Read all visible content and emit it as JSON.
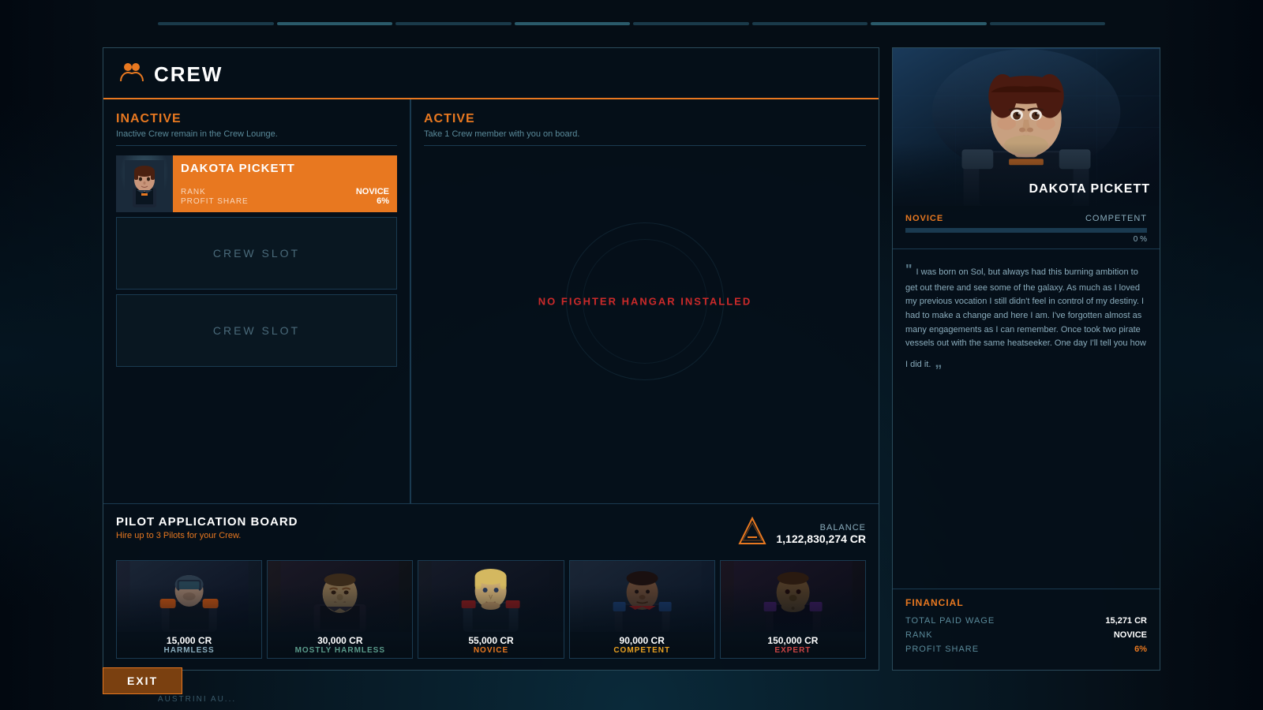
{
  "page": {
    "title": "CREW",
    "background_color": "#050d15"
  },
  "header": {
    "crew_icon": "👥",
    "title": "CREW"
  },
  "inactive_section": {
    "title": "INACTIVE",
    "subtitle": "Inactive Crew remain in the Crew Lounge.",
    "crew_member": {
      "name": "DAKOTA PICKETT",
      "rank_label": "RANK",
      "rank_value": "NOVICE",
      "profit_share_label": "PROFIT SHARE",
      "profit_share_value": "6%"
    },
    "slots": [
      {
        "label": "CREW SLOT"
      },
      {
        "label": "CREW SLOT"
      }
    ]
  },
  "active_section": {
    "title": "ACTIVE",
    "subtitle": "Take 1 Crew member with you on board.",
    "no_hangar_message": "NO FIGHTER HANGAR INSTALLED"
  },
  "pilot_board": {
    "title": "PILOT APPLICATION BOARD",
    "subtitle": "Hire up to 3 Pilots for your Crew.",
    "balance_label": "BALANCE",
    "balance_amount": "1,122,830,274 CR",
    "pilots": [
      {
        "cost": "15,000 CR",
        "rank": "HARMLESS",
        "rank_class": "rank-harmless"
      },
      {
        "cost": "30,000 CR",
        "rank": "MOSTLY HARMLESS",
        "rank_class": "rank-mostly-harmless"
      },
      {
        "cost": "55,000 CR",
        "rank": "NOVICE",
        "rank_class": "rank-novice"
      },
      {
        "cost": "90,000 CR",
        "rank": "COMPETENT",
        "rank_class": "rank-competent"
      },
      {
        "cost": "150,000 CR",
        "rank": "EXPERT",
        "rank_class": "rank-expert"
      }
    ]
  },
  "detail_panel": {
    "character_name": "DAKOTA PICKETT",
    "rank_left": "NOVICE",
    "rank_right": "COMPETENT",
    "xp_percent": "0 %",
    "xp_fill": 0,
    "bio": "I was born on Sol, but always had this burning ambition to get out there and see some of the galaxy. As much as I loved my previous vocation I still didn't feel in control of my destiny. I had to make a change and here I am. I've forgotten almost as many engagements as I can remember. Once took two pirate vessels out with the same heatseeker. One day I'll tell you how I did it.",
    "financial_title": "FINANCIAL",
    "financials": [
      {
        "label": "TOTAL PAID WAGE",
        "value": "15,271 CR",
        "orange": false
      },
      {
        "label": "RANK",
        "value": "NOVICE",
        "orange": false
      },
      {
        "label": "PROFIT SHARE",
        "value": "6%",
        "orange": true
      }
    ]
  },
  "exit_button": {
    "label": "EXIT"
  },
  "bottom_status": {
    "text": "AUSTRINI AU..."
  }
}
